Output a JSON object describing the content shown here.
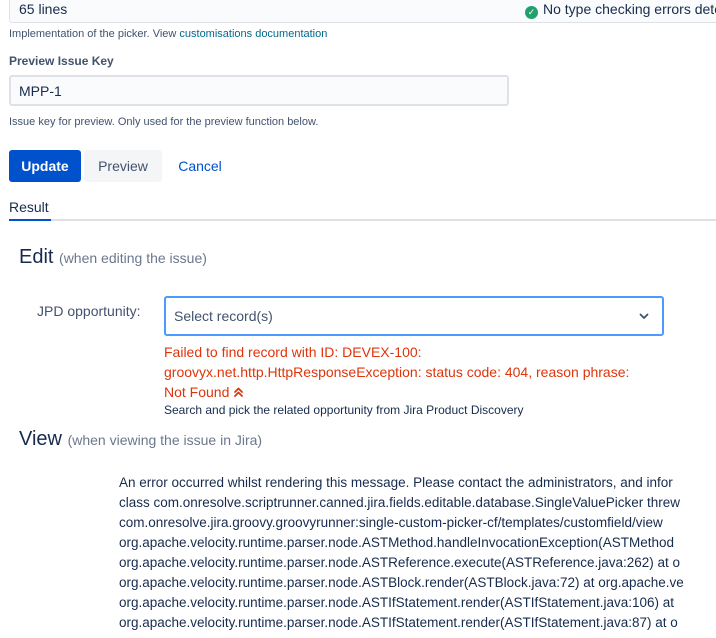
{
  "editor": {
    "lines_count": "65 lines",
    "type_check_message": "No type checking errors dete"
  },
  "picker_help": {
    "prefix": "Implementation of the picker. View ",
    "link": "customisations documentation"
  },
  "preview_issue_key": {
    "label": "Preview Issue Key",
    "value": "MPP-1",
    "help": "Issue key for preview. Only used for the preview function below."
  },
  "buttons": {
    "update": "Update",
    "preview": "Preview",
    "cancel": "Cancel"
  },
  "tabs": {
    "result": "Result"
  },
  "edit_section": {
    "title": "Edit",
    "subtitle": "(when editing the issue)",
    "field_label": "JPD opportunity:",
    "select_placeholder": "Select record(s)",
    "error_lines": [
      "Failed to find record with ID: DEVEX-100:",
      "groovyx.net.http.HttpResponseException: status code: 404, reason phrase:",
      "Not Found"
    ],
    "field_description": "Search and pick the related opportunity from Jira Product Discovery"
  },
  "view_section": {
    "title": "View",
    "subtitle": "(when viewing the issue in Jira)",
    "error_lines": [
      "An error occurred whilst rendering this message. Please contact the administrators, and infor",
      "class com.onresolve.scriptrunner.canned.jira.fields.editable.database.SingleValuePicker threw",
      "com.onresolve.jira.groovy.groovyrunner:single-custom-picker-cf/templates/customfield/view",
      "org.apache.velocity.runtime.parser.node.ASTMethod.handleInvocationException(ASTMethod",
      "org.apache.velocity.runtime.parser.node.ASTReference.execute(ASTReference.java:262) at o",
      "org.apache.velocity.runtime.parser.node.ASTBlock.render(ASTBlock.java:72) at org.apache.ve",
      "org.apache.velocity.runtime.parser.node.ASTIfStatement.render(ASTIfStatement.java:106) at",
      "org.apache.velocity.runtime.parser.node.ASTIfStatement.render(ASTIfStatement.java:87) at o"
    ]
  },
  "colors": {
    "primary": "#0052cc",
    "error": "#de350b",
    "success": "#22a06b"
  }
}
